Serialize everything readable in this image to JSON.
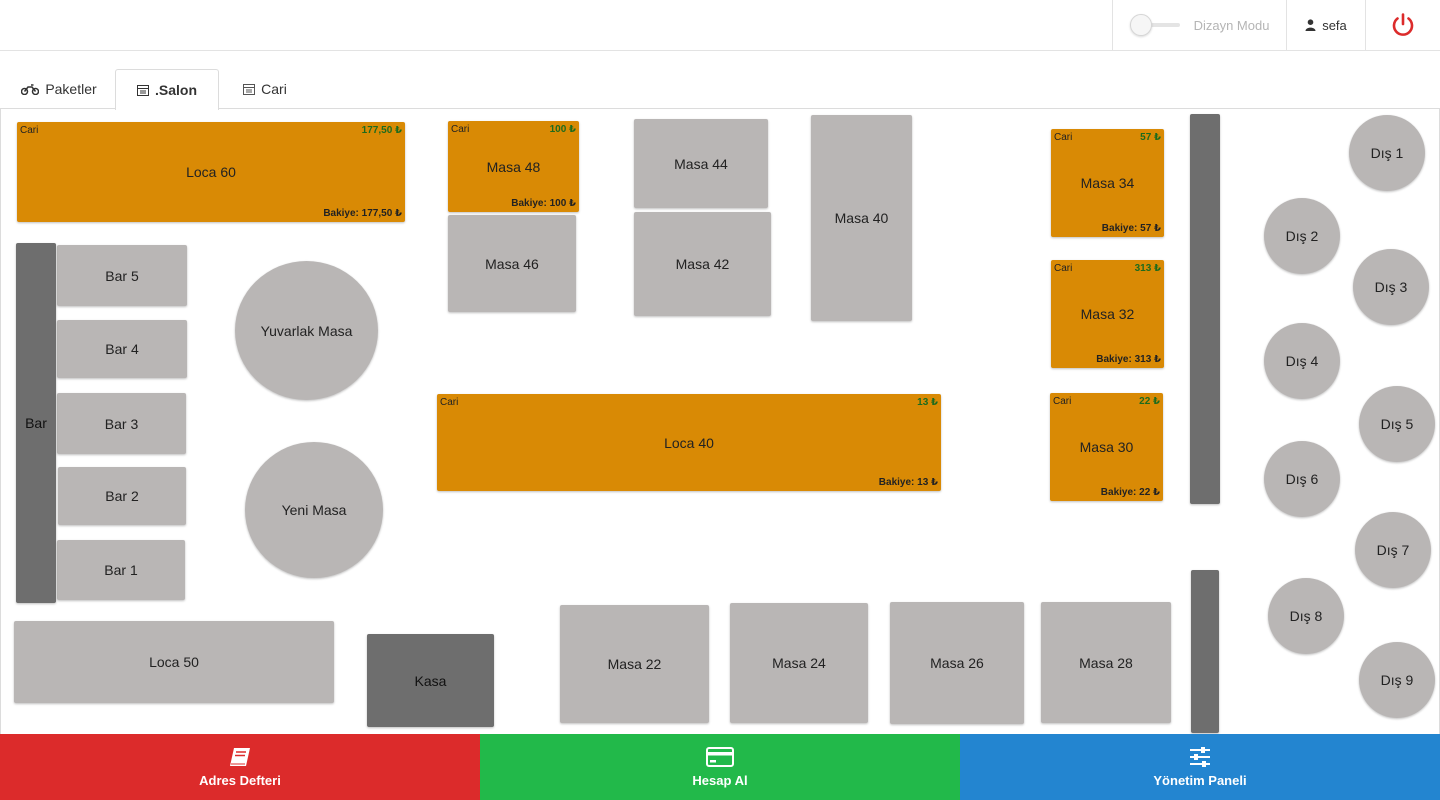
{
  "header": {
    "design_mode_label": "Dizayn Modu",
    "design_mode_on": false,
    "user_name": "sefa"
  },
  "tabs": [
    {
      "label": "Paketler",
      "icon": "motorcycle-icon",
      "active": false
    },
    {
      "label": ".Salon",
      "icon": "table-icon",
      "active": true
    },
    {
      "label": "Cari",
      "icon": "table-icon",
      "active": false
    }
  ],
  "floor": {
    "cari_label": "Cari",
    "tables": {
      "loca60": {
        "name": "Loca 60",
        "amount": "177,50 ₺",
        "balance": "Bakiye: 177,50 ₺"
      },
      "masa48": {
        "name": "Masa 48",
        "amount": "100 ₺",
        "balance": "Bakiye: 100 ₺"
      },
      "masa46": {
        "name": "Masa 46"
      },
      "masa44": {
        "name": "Masa 44"
      },
      "masa42": {
        "name": "Masa 42"
      },
      "masa40": {
        "name": "Masa 40"
      },
      "masa34": {
        "name": "Masa 34",
        "amount": "57 ₺",
        "balance": "Bakiye: 57 ₺"
      },
      "masa32": {
        "name": "Masa 32",
        "amount": "313 ₺",
        "balance": "Bakiye: 313 ₺"
      },
      "masa30": {
        "name": "Masa 30",
        "amount": "22 ₺",
        "balance": "Bakiye: 22 ₺"
      },
      "loca40": {
        "name": "Loca 40",
        "amount": "13 ₺",
        "balance": "Bakiye: 13 ₺"
      },
      "bar": {
        "name": "Bar"
      },
      "bar5": {
        "name": "Bar 5"
      },
      "bar4": {
        "name": "Bar 4"
      },
      "bar3": {
        "name": "Bar 3"
      },
      "bar2": {
        "name": "Bar 2"
      },
      "bar1": {
        "name": "Bar 1"
      },
      "yuvarlak": {
        "name": "Yuvarlak Masa"
      },
      "yeni": {
        "name": "Yeni Masa"
      },
      "loca50": {
        "name": "Loca 50"
      },
      "kasa": {
        "name": "Kasa"
      },
      "masa22": {
        "name": "Masa 22"
      },
      "masa24": {
        "name": "Masa 24"
      },
      "masa26": {
        "name": "Masa 26"
      },
      "masa28": {
        "name": "Masa 28"
      },
      "dis1": {
        "name": "Dış 1"
      },
      "dis2": {
        "name": "Dış 2"
      },
      "dis3": {
        "name": "Dış 3"
      },
      "dis4": {
        "name": "Dış 4"
      },
      "dis5": {
        "name": "Dış 5"
      },
      "dis6": {
        "name": "Dış 6"
      },
      "dis7": {
        "name": "Dış 7"
      },
      "dis8": {
        "name": "Dış 8"
      },
      "dis9": {
        "name": "Dış 9"
      }
    }
  },
  "actions": {
    "address_book": "Adres Defteri",
    "checkout": "Hesap Al",
    "admin_panel": "Yönetim Paneli"
  },
  "colors": {
    "occupied": "#d98a05",
    "empty": "#b9b6b5",
    "structure": "#6e6e6e",
    "red": "#dc2b2b",
    "green": "#22b94a",
    "blue": "#2385d0"
  }
}
